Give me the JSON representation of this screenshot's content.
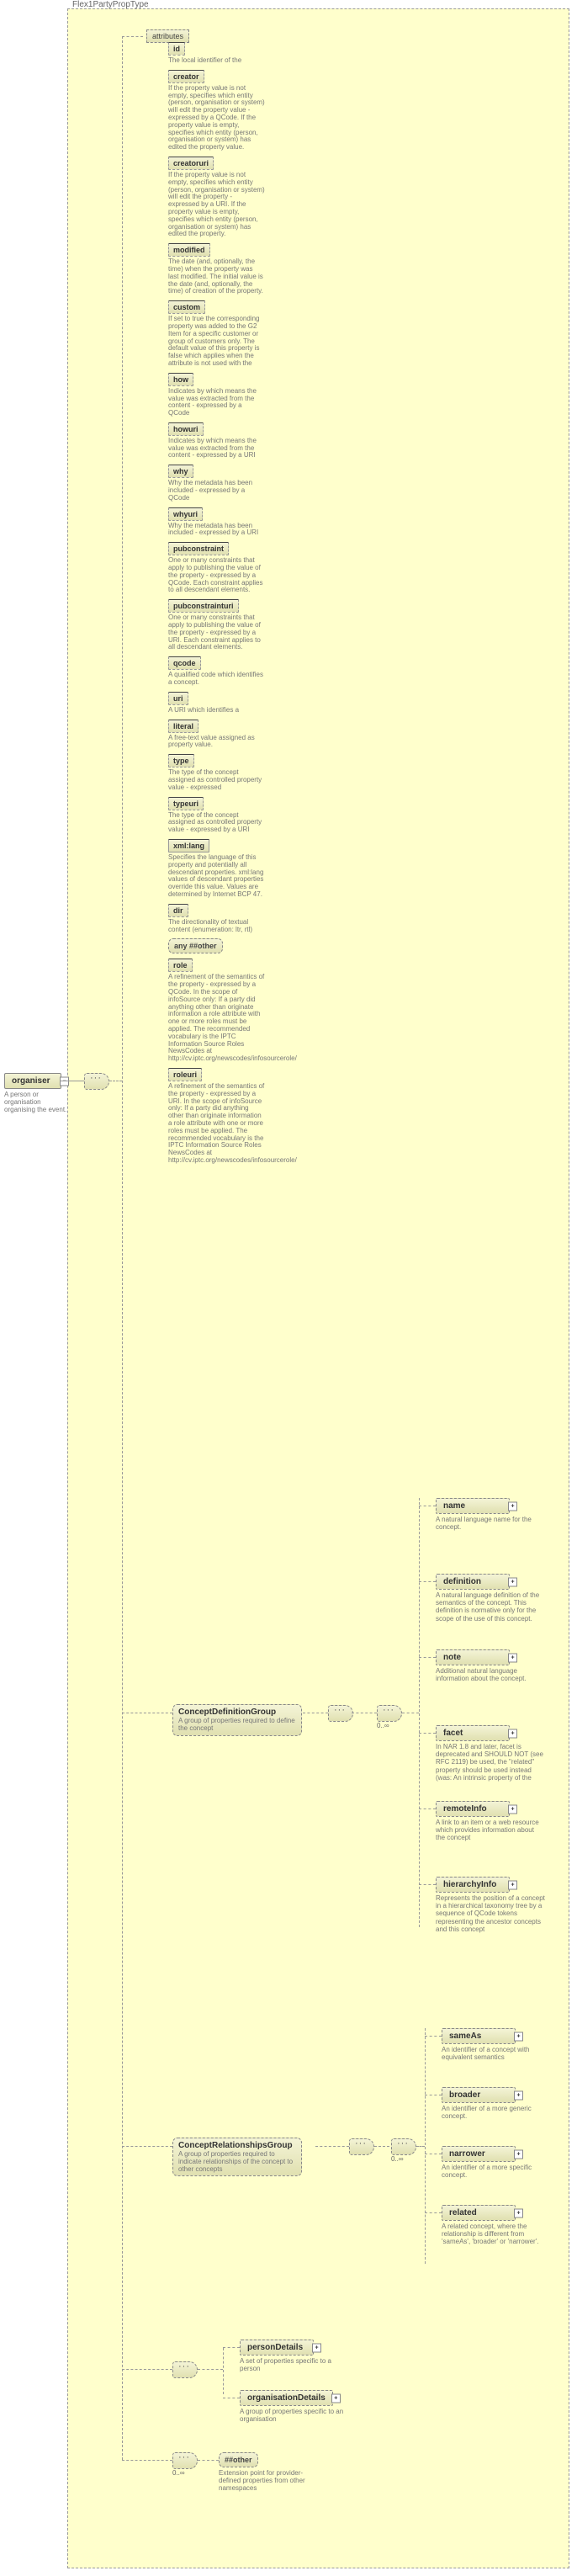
{
  "title": "Flex1PartyPropType",
  "root": {
    "name": "organiser",
    "desc": "A person or organisation organising the event."
  },
  "attributes_label": "attributes",
  "attributes": [
    {
      "name": "id",
      "solid": false,
      "desc": "The local identifier of the"
    },
    {
      "name": "creator",
      "solid": false,
      "desc": "If the property value is not empty, specifies which entity (person, organisation or system) will edit the property value - expressed by a QCode. If the property value is empty, specifies which entity (person, organisation or system) has edited the property value."
    },
    {
      "name": "creatoruri",
      "solid": false,
      "desc": "If the property value is not empty, specifies which entity (person, organisation or system) will edit the property - expressed by a URI. If the property value is empty, specifies which entity (person, organisation or system) has edited the property."
    },
    {
      "name": "modified",
      "solid": false,
      "desc": "The date (and, optionally, the time) when the property was last modified. The initial value is the date (and, optionally, the time) of creation of the property."
    },
    {
      "name": "custom",
      "solid": false,
      "desc": "If set to true the corresponding property was added to the G2 Item for a specific customer or group of customers only. The default value of this property is false which applies when the attribute is not used with the"
    },
    {
      "name": "how",
      "solid": false,
      "desc": "Indicates by which means the value was extracted from the content - expressed by a QCode"
    },
    {
      "name": "howuri",
      "solid": false,
      "desc": "Indicates by which means the value was extracted from the content - expressed by a URI"
    },
    {
      "name": "why",
      "solid": false,
      "desc": "Why the metadata has been included - expressed by a QCode"
    },
    {
      "name": "whyuri",
      "solid": false,
      "desc": "Why the metadata has been included - expressed by a URI"
    },
    {
      "name": "pubconstraint",
      "solid": false,
      "desc": "One or many constraints that apply to publishing the value of the property - expressed by a QCode. Each constraint applies to all descendant elements."
    },
    {
      "name": "pubconstrainturi",
      "solid": false,
      "desc": "One or many constraints that apply to publishing the value of the property - expressed by a URI. Each constraint applies to all descendant elements."
    },
    {
      "name": "qcode",
      "solid": false,
      "desc": "A qualified code which identifies a concept."
    },
    {
      "name": "uri",
      "solid": false,
      "desc": "A URI which identifies a"
    },
    {
      "name": "literal",
      "solid": false,
      "desc": "A free-text value assigned as property value."
    },
    {
      "name": "type",
      "solid": false,
      "desc": "The type of the concept assigned as controlled property value - expressed"
    },
    {
      "name": "typeuri",
      "solid": false,
      "desc": "The type of the concept assigned as controlled property value - expressed by a URI"
    },
    {
      "name": "xml:lang",
      "solid": true,
      "desc": "Specifies the language of this property and potentially all descendant properties. xml:lang values of descendant properties override this value. Values are determined by Internet BCP 47."
    },
    {
      "name": "dir",
      "solid": false,
      "desc": "The directionality of textual content (enumeration: ltr, rtl)"
    },
    {
      "name": "any ##other",
      "solid": true,
      "any": true,
      "desc": ""
    },
    {
      "name": "role",
      "solid": false,
      "desc": "A refinement of the semantics of the property - expressed by a QCode. In the scope of infoSource only: If a party did anything other than originate information a role attribute with one or more roles must be applied. The recommended vocabulary is the IPTC Information Source Roles NewsCodes at http://cv.iptc.org/newscodes/infosourcerole/"
    },
    {
      "name": "roleuri",
      "solid": false,
      "desc": "A refinement of the semantics of the property - expressed by a URI. In the scope of infoSource only: If a party did anything other than originate information a role attribute with one or more roles must be applied. The recommended vocabulary is the IPTC Information Source Roles NewsCodes at http://cv.iptc.org/newscodes/infosourcerole/"
    }
  ],
  "cdg": {
    "label": "ConceptDefinitionGroup",
    "desc": "A group of properties required to define the concept",
    "mult": "0..∞",
    "children": [
      {
        "name": "name",
        "desc": "A natural language name for the concept."
      },
      {
        "name": "definition",
        "desc": "A natural language definition of the semantics of the concept. This definition is normative only for the scope of the use of this concept."
      },
      {
        "name": "note",
        "desc": "Additional natural language information about the concept."
      },
      {
        "name": "facet",
        "desc": "In NAR 1.8 and later, facet is deprecated and SHOULD NOT (see RFC 2119) be used, the \"related\" property should be used instead (was: An intrinsic property of the"
      },
      {
        "name": "remoteInfo",
        "desc": "A link to an item or a web resource which provides information about the concept"
      },
      {
        "name": "hierarchyInfo",
        "desc": "Represents the position of a concept in a hierarchical taxonomy tree by a sequence of QCode tokens representing the ancestor concepts and this concept"
      }
    ]
  },
  "crg": {
    "label": "ConceptRelationshipsGroup",
    "desc": "A group of properties required to indicate relationships of the concept to other concepts",
    "mult": "0..∞",
    "children": [
      {
        "name": "sameAs",
        "desc": "An identifier of a concept with equivalent semantics"
      },
      {
        "name": "broader",
        "desc": "An identifier of a more generic concept."
      },
      {
        "name": "narrower",
        "desc": "An identifier of a more specific concept."
      },
      {
        "name": "related",
        "desc": "A related concept, where the relationship is different from 'sameAs', 'broader' or 'narrower'."
      }
    ]
  },
  "choiceChildren": [
    {
      "name": "personDetails",
      "desc": "A set of properties specific to a person"
    },
    {
      "name": "organisationDetails",
      "desc": "A group of properties specific to an organisation"
    }
  ],
  "anyOther": {
    "label": "##other",
    "desc": "Extension point for provider-defined properties from other namespaces",
    "mult": "0..∞"
  }
}
